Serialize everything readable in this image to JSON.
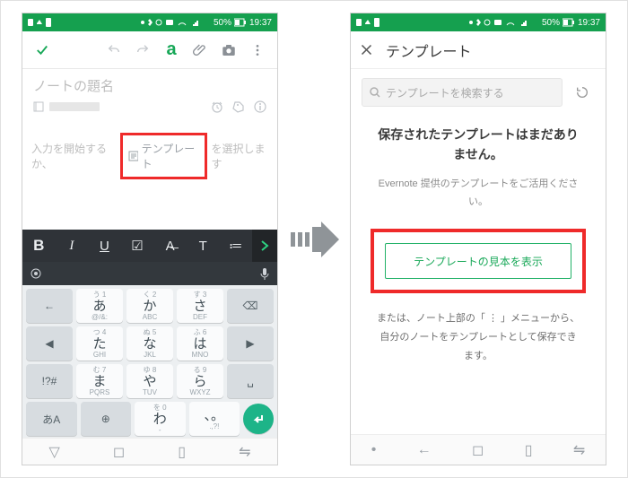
{
  "status": {
    "time": "19:37",
    "battery": "50%",
    "icons": [
      "lock",
      "usb",
      "bolt",
      "loc",
      "bt",
      "mute",
      "nfc",
      "wifi",
      "sig"
    ]
  },
  "left": {
    "note_title_placeholder": "ノートの題名",
    "body_prefix": "入力を開始するか、",
    "template_btn": "テンプレート",
    "body_suffix": "を選択します",
    "fmt_labels": [
      "B",
      "I",
      "U",
      "☑",
      "A̶",
      "T",
      "≔"
    ],
    "keyboard": {
      "rows": [
        [
          {
            "type": "func",
            "label": "←"
          },
          {
            "small": "う 1",
            "kana": "あ",
            "roma": "@/&:"
          },
          {
            "small": "く 2",
            "kana": "か",
            "roma": "ABC"
          },
          {
            "small": "す 3",
            "kana": "さ",
            "roma": "DEF"
          },
          {
            "type": "func",
            "label": "⌫"
          }
        ],
        [
          {
            "type": "func",
            "label": "◀"
          },
          {
            "small": "つ 4",
            "kana": "た",
            "roma": "GHI"
          },
          {
            "small": "ぬ 5",
            "kana": "な",
            "roma": "JKL"
          },
          {
            "small": "ふ 6",
            "kana": "は",
            "roma": "MNO"
          },
          {
            "type": "func",
            "label": "▶"
          }
        ],
        [
          {
            "type": "func",
            "label": "!?#"
          },
          {
            "small": "む 7",
            "kana": "ま",
            "roma": "PQRS"
          },
          {
            "small": "ゆ 8",
            "kana": "や",
            "roma": "TUV"
          },
          {
            "small": "る 9",
            "kana": "ら",
            "roma": "WXYZ"
          },
          {
            "type": "func",
            "label": "␣"
          }
        ],
        [
          {
            "type": "func",
            "label": "あA"
          },
          {
            "type": "func",
            "label": "⊕"
          },
          {
            "small": "を 0",
            "kana": "わ",
            "roma": "-"
          },
          {
            "small": "",
            "kana": "、。",
            "roma": ".,?!"
          },
          {
            "type": "enter",
            "label": "↵"
          }
        ]
      ]
    },
    "nav": [
      "▽",
      "◻",
      "▯",
      "⇋"
    ]
  },
  "right": {
    "header_title": "テンプレート",
    "search_placeholder": "テンプレートを検索する",
    "empty_title": "保存されたテンプレートはまだありません。",
    "empty_sub": "Evernote 提供のテンプレートをご活用ください。",
    "cta_label": "テンプレートの見本を表示",
    "hint": "または、ノート上部の「 ⋮ 」メニューから、自分のノートをテンプレートとして保存できます。",
    "nav": [
      "•",
      "←",
      "◻",
      "▯",
      "⇋"
    ]
  }
}
